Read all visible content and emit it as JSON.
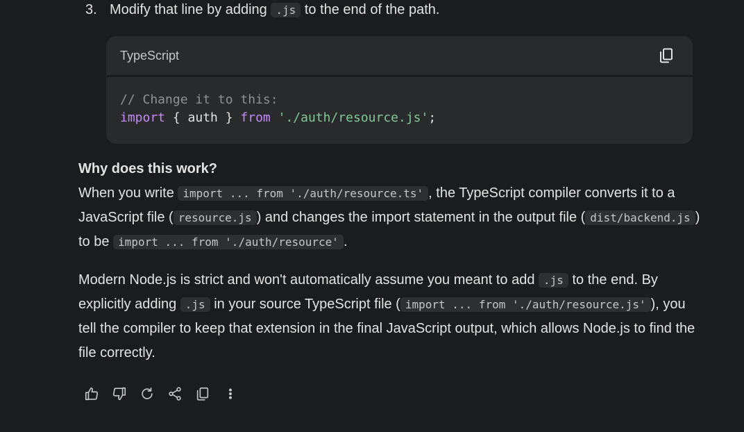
{
  "step": {
    "number": "3.",
    "text_before": "Modify that line by adding ",
    "code": ".js",
    "text_after": " to the end of the path."
  },
  "code_block": {
    "language": "TypeScript",
    "copy_icon": "copy-icon",
    "comment": "// Change it to this:",
    "line2": {
      "kw_import": "import",
      "braces_open": " { auth } ",
      "kw_from": "from",
      "space": " ",
      "string": "'./auth/resource.js'",
      "semicolon": ";"
    }
  },
  "explanation": {
    "heading": "Why does this work?",
    "p1": {
      "t1": "When you write ",
      "c1": "import ... from './auth/resource.ts'",
      "t2": ", the TypeScript compiler converts it to a JavaScript file (",
      "c2": "resource.js",
      "t3": ") and changes the import statement in the output file (",
      "c3": "dist/backend.js",
      "t4": ") to be ",
      "c4": "import ... from './auth/resource'",
      "t5": "."
    },
    "p2": {
      "t1": "Modern Node.js is strict and won't automatically assume you meant to add ",
      "c1": ".js",
      "t2": " to the end. By explicitly adding ",
      "c2": ".js",
      "t3": " in your source TypeScript file (",
      "c3": "import ... from './auth/resource.js'",
      "t4": "), you tell the compiler to keep that extension in the final JavaScript output, which allows Node.js to find the file correctly."
    }
  },
  "actions": {
    "icons": [
      "thumbs-up-icon",
      "thumbs-down-icon",
      "regenerate-icon",
      "share-icon",
      "copy-icon",
      "more-vert-icon"
    ]
  }
}
